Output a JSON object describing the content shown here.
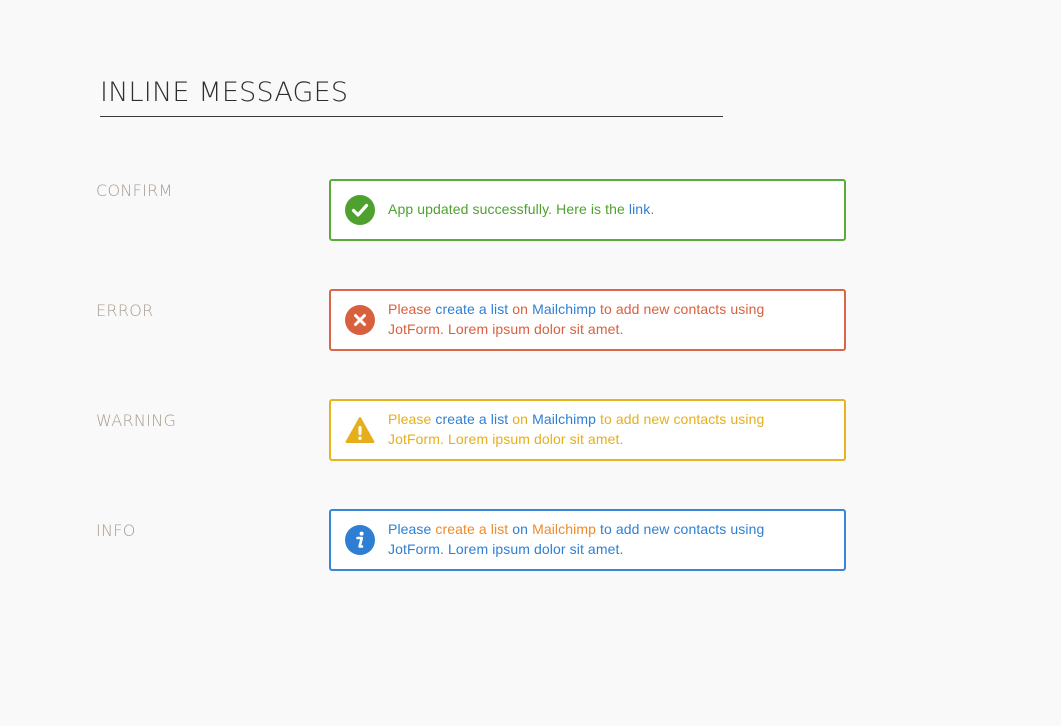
{
  "title": "INLINE MESSAGES",
  "colors": {
    "confirm": "#5aab3a",
    "error": "#d9654a",
    "warning": "#e7b321",
    "info": "#3a85d8",
    "link_blue": "#2e7fd3",
    "link_orange": "#ef8a2a"
  },
  "confirm": {
    "label": "CONFIRM",
    "icon": "check-circle-icon",
    "text_before": "App updated successfully. Here is the ",
    "link": "link",
    "text_after": "."
  },
  "error": {
    "label": "ERROR",
    "icon": "x-circle-icon",
    "text_before": "Please ",
    "link1": "create a list",
    "text_mid1": " on ",
    "link2": "Mailchimp",
    "text_after": " to add new contacts using JotForm. Lorem ipsum dolor sit amet."
  },
  "warning": {
    "label": "WARNING",
    "icon": "warning-triangle-icon",
    "text_before": "Please ",
    "link1": "create a list",
    "text_mid1": " on ",
    "link2": "Mailchimp",
    "text_after": " to add new contacts using JotForm. Lorem ipsum dolor sit amet."
  },
  "info": {
    "label": "INFO",
    "icon": "info-circle-icon",
    "text_before": "Please ",
    "link1": "create a list",
    "text_mid1": " on ",
    "link2": "Mailchimp",
    "text_after": " to add new contacts using JotForm. Lorem ipsum dolor sit amet."
  }
}
